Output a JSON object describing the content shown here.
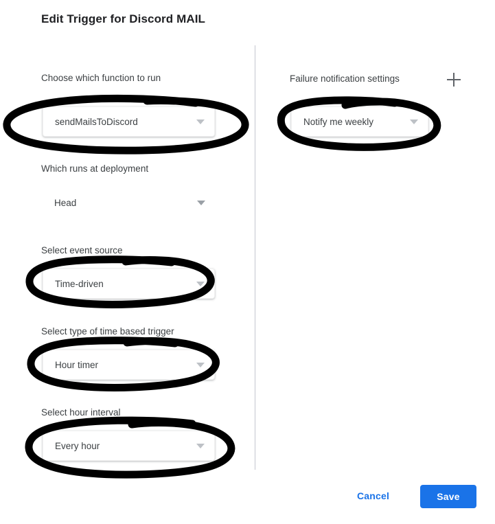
{
  "dialog": {
    "title": "Edit Trigger for Discord MAIL"
  },
  "left_column": {
    "fields": [
      {
        "label": "Choose which function to run",
        "value": "sendMailsToDiscord",
        "style": "boxed",
        "annotated": true
      },
      {
        "label": "Which runs at deployment",
        "value": "Head",
        "style": "flat",
        "annotated": false
      },
      {
        "label": "Select event source",
        "value": "Time-driven",
        "style": "boxed",
        "annotated": true
      },
      {
        "label": "Select type of time based trigger",
        "value": "Hour timer",
        "style": "boxed",
        "annotated": true
      },
      {
        "label": "Select hour interval",
        "value": "Every hour",
        "style": "boxed",
        "annotated": true
      }
    ]
  },
  "right_column": {
    "label": "Failure notification settings",
    "add_icon": "plus-icon",
    "field": {
      "value": "Notify me weekly",
      "style": "boxed",
      "annotated": true
    }
  },
  "footer": {
    "cancel_label": "Cancel",
    "save_label": "Save"
  },
  "colors": {
    "accent": "#1a73e8",
    "label_text": "#3c4043",
    "title_text": "#202124",
    "divider": "#c4c6cf",
    "caret": "#bdc1c6",
    "annotation": "#000000",
    "background": "#ffffff"
  },
  "annotations": {
    "type": "hand-drawn-marker-ellipse",
    "count": 5,
    "color": "#000000"
  }
}
